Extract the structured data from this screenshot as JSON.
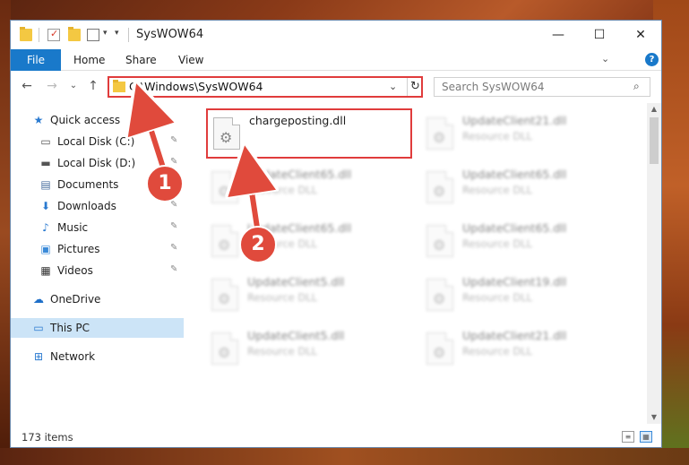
{
  "window": {
    "title": "SysWOW64",
    "minimize_glyph": "—",
    "maximize_glyph": "☐",
    "close_glyph": "✕"
  },
  "ribbon": {
    "file_label": "File",
    "tabs": [
      "Home",
      "Share",
      "View"
    ],
    "expand_glyph": "⌄",
    "help_glyph": "?"
  },
  "navigation": {
    "back_glyph": "←",
    "forward_glyph": "→",
    "recent_glyph": "⌄",
    "up_glyph": "↑"
  },
  "address": {
    "path": "C:\\Windows\\SysWOW64",
    "dropdown_glyph": "⌄",
    "refresh_glyph": "↻"
  },
  "search": {
    "placeholder": "Search SysWOW64",
    "icon_glyph": "⌕"
  },
  "sidebar": {
    "items": [
      {
        "label": "Quick access",
        "icon": "star-icon",
        "glyph": "★",
        "pinned": false
      },
      {
        "label": "Local Disk (C:)",
        "icon": "drive-icon",
        "glyph": "▭",
        "pinned": true
      },
      {
        "label": "Local Disk (D:)",
        "icon": "drive-icon",
        "glyph": "▬",
        "pinned": true
      },
      {
        "label": "Documents",
        "icon": "documents-icon",
        "glyph": "▤",
        "pinned": true
      },
      {
        "label": "Downloads",
        "icon": "downloads-icon",
        "glyph": "⬇",
        "pinned": true
      },
      {
        "label": "Music",
        "icon": "music-icon",
        "glyph": "♪",
        "pinned": true
      },
      {
        "label": "Pictures",
        "icon": "pictures-icon",
        "glyph": "▣",
        "pinned": true
      },
      {
        "label": "Videos",
        "icon": "videos-icon",
        "glyph": "▦",
        "pinned": true
      },
      {
        "label": "OneDrive",
        "icon": "cloud-icon",
        "glyph": "☁",
        "pinned": false
      },
      {
        "label": "This PC",
        "icon": "computer-icon",
        "glyph": "▭",
        "pinned": false,
        "selected": true
      },
      {
        "label": "Network",
        "icon": "network-icon",
        "glyph": "⊞",
        "pinned": false
      }
    ],
    "pin_glyph": "✎"
  },
  "files": [
    {
      "name": "chargeposting.dll",
      "type": "",
      "highlighted": true
    },
    {
      "name": "UpdateClient21.dll",
      "type": "Resource DLL",
      "blurred": true
    },
    {
      "name": "UpdateClient65.dll",
      "type": "Resource DLL",
      "blurred": true
    },
    {
      "name": "UpdateClient65.dll",
      "type": "Resource DLL",
      "blurred": true
    },
    {
      "name": "UpdateClient65.dll",
      "type": "Resource DLL",
      "blurred": true
    },
    {
      "name": "UpdateClient65.dll",
      "type": "Resource DLL",
      "blurred": true
    },
    {
      "name": "UpdateClient5.dll",
      "type": "Resource DLL",
      "blurred": true
    },
    {
      "name": "UpdateClient19.dll",
      "type": "Resource DLL",
      "blurred": true
    },
    {
      "name": "UpdateClient5.dll",
      "type": "Resource DLL",
      "blurred": true
    },
    {
      "name": "UpdateClient21.dll",
      "type": "Resource DLL",
      "blurred": true
    }
  ],
  "status": {
    "item_count": "173 items"
  },
  "annotations": {
    "step_1": "1",
    "step_2": "2",
    "color": "#e04a3c"
  }
}
